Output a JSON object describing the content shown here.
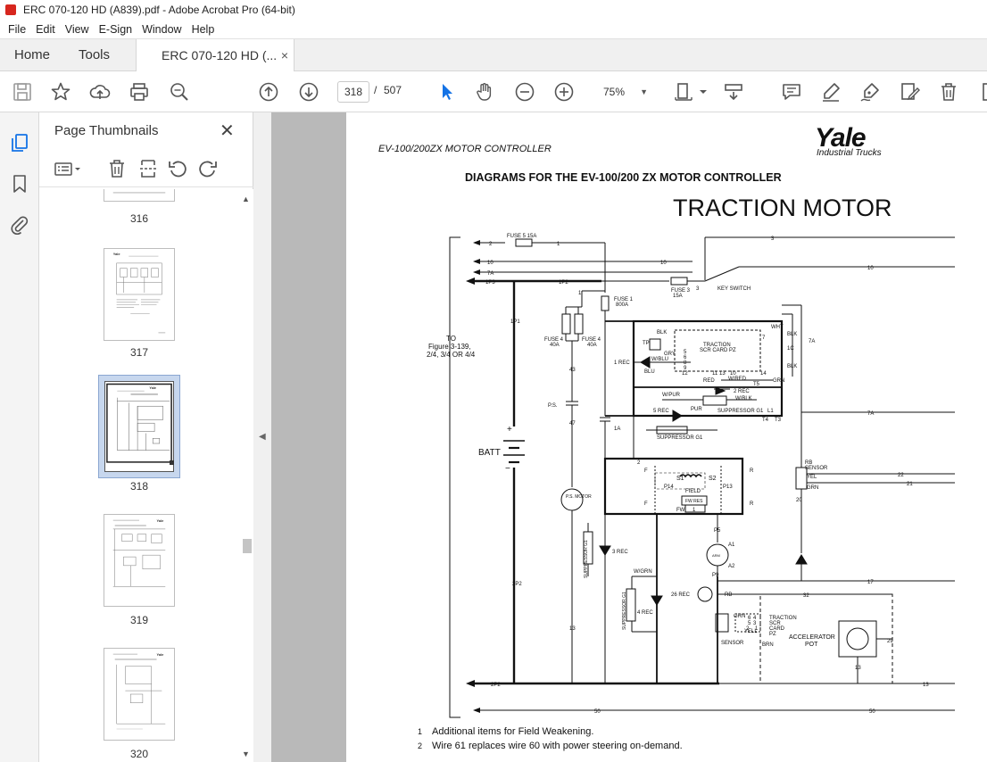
{
  "window": {
    "title": "ERC 070-120 HD (A839).pdf - Adobe Acrobat Pro (64-bit)"
  },
  "menu": [
    "File",
    "Edit",
    "View",
    "E-Sign",
    "Window",
    "Help"
  ],
  "tabs": {
    "home": "Home",
    "tools": "Tools",
    "document": "ERC 070-120 HD (...",
    "close": "×"
  },
  "toolbar": {
    "current_page": "318",
    "page_sep": "/",
    "page_count": "507",
    "zoom": "75%"
  },
  "panel": {
    "title": "Page Thumbnails",
    "close": "✕",
    "thumbnails": [
      {
        "label": "316"
      },
      {
        "label": "317"
      },
      {
        "label": "318"
      },
      {
        "label": "319"
      },
      {
        "label": "320"
      }
    ]
  },
  "document": {
    "header_left": "EV-100/200ZX MOTOR CONTROLLER",
    "logo_brand": "Yale",
    "logo_sub": "Industrial Trucks",
    "heading": "DIAGRAMS FOR THE EV-100/200 ZX MOTOR CONTROLLER",
    "big_title": "TRACTION MOTOR",
    "notes": [
      "Additional items for Field Weakening.",
      "Wire 61 replaces wire 60 with power steering on-demand."
    ],
    "note_marks": [
      "1",
      "2"
    ],
    "diagram_labels": {
      "fuse5": "FUSE 5 15A",
      "w2": "2",
      "w1": "1",
      "w3": "3",
      "w10a": "10",
      "w10b": "10",
      "w10c": "10",
      "w7a": "7A",
      "w1p3": "1P3",
      "w1p2": "1P2",
      "fuse3": "FUSE 3",
      "fuse3a": "15A",
      "keyswitch": "KEY SWITCH",
      "fuse1": "FUSE 1",
      "fuse1a": "800A",
      "w1p1": "1P1",
      "to_label": "TO",
      "figure": "Figure 3-139,",
      "figure2": "2/4, 3/4 OR 4/4",
      "fuse4a": "FUSE 4",
      "fuse4a2": "40A",
      "fuse4b": "FUSE 4",
      "fuse4b2": "40A",
      "w43": "43",
      "ps": "P.S.",
      "w47": "47",
      "w1a": "1A",
      "batt": "BATT",
      "plus": "+",
      "minus": "−",
      "psmotor": "P.S. MOTOR",
      "supp1": "SUPPRESSOR G1",
      "supp2": "SUPPRESSOR G1",
      "w2p2": "2P2",
      "w2p2b": "2P2",
      "w13": "13",
      "traction_scr": "TRACTION",
      "traction_scr2": "SCR CARD PZ",
      "blk": "BLK",
      "tp": "TP",
      "wblu": "W/BLU",
      "gry": "GRY",
      "blu": "BLU",
      "rec1": "1 REC",
      "red": "RED",
      "wred": "W/RED",
      "rec2": "2 REC",
      "t5": "T5",
      "wpur": "W/PUR",
      "pur": "PUR",
      "wblk": "W/BLK",
      "rec5": "5 REC",
      "suppg1a": "SUPPRESSOR G1",
      "suppg1b": "SUPPRESSOR G1",
      "wht": "WHT",
      "blk2": "BLK",
      "blk3": "BLK",
      "grn": "GRN",
      "t4": "T4",
      "t3": "T3",
      "l1": "L1",
      "w7ab": "7A",
      "w7ac": "7A",
      "s1": "S1",
      "s2": "S2",
      "p14": "P14",
      "p13": "P13",
      "field": "FIELD",
      "fwres": "FW RES",
      "fw": "FW",
      "f1": "F",
      "f2": "F",
      "r1": "R",
      "r2": "R",
      "p5": "P5",
      "a1": "A1",
      "a2": "A2",
      "arm": "ARM",
      "p9": "P9",
      "rec3": "3 REC",
      "rec4": "4 REC",
      "wgrn": "W/GRN",
      "rec26": "26 REC",
      "rb": "RB",
      "rbsensor": "RB",
      "rbsensor2": "SENSOR",
      "yel": "YEL",
      "grn2": "GRN",
      "w22": "22",
      "w21": "21",
      "w20": "20",
      "w17": "17",
      "w32": "32",
      "grn3": "GRN",
      "yell": "YELL",
      "sensor": "SENSOR",
      "brn": "BRN",
      "traction2": "TRACTION",
      "scr2": "SCR",
      "card2": "CARD",
      "pz2": "PZ",
      "accel": "ACCELERATOR",
      "pot": "POT",
      "w29": "29",
      "w13b": "13",
      "w13c": "13",
      "w50a": "50",
      "w50b": "50",
      "n7": "7",
      "n5": "5",
      "n6": "6",
      "n8": "8",
      "n9": "9",
      "n12": "12",
      "n11": "11",
      "n13": "13",
      "n10": "10",
      "n14": "14",
      "n1": "1",
      "n2": "2",
      "n4": "4",
      "n3": "3",
      "n6b": "6",
      "n5b": "5",
      "n1c": "1C",
      "n7x": "7",
      "n2x": "2",
      "n3x": "3",
      "n1x": "1"
    }
  },
  "colors": {
    "accent": "#1473e6",
    "pane": "#b9b9b9"
  }
}
